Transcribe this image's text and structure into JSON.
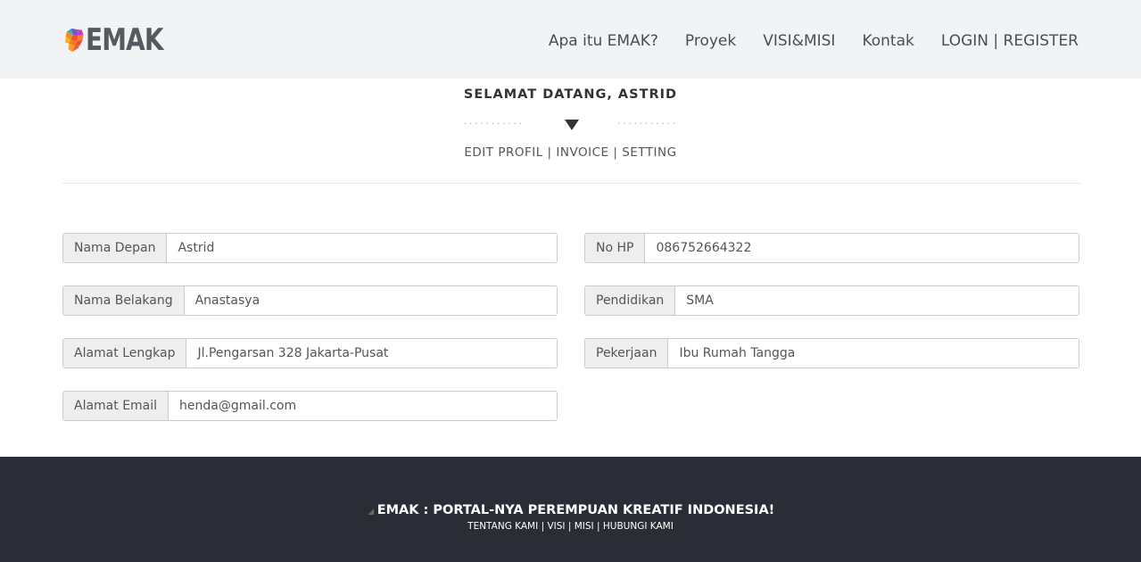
{
  "header": {
    "logo_text": "EMAK",
    "nav": [
      "Apa itu EMAK?",
      "Proyek",
      "VISI&MISI",
      "Kontak",
      "LOGIN | REGISTER"
    ]
  },
  "welcome": {
    "title": "SELAMAT DATANG, ASTRID",
    "dots": "...........",
    "menu": [
      "EDIT PROFIL",
      "INVOICE",
      "SETTING"
    ],
    "separator": "|"
  },
  "form": {
    "first_name": {
      "label": "Nama Depan",
      "value": "Astrid"
    },
    "last_name": {
      "label": "Nama Belakang",
      "value": "Anastasya"
    },
    "address": {
      "label": "Alamat Lengkap",
      "value": "Jl.Pengarsan 328 Jakarta-Pusat"
    },
    "email": {
      "label": "Alamat Email",
      "value": "henda@gmail.com"
    },
    "phone": {
      "label": "No HP",
      "value": "086752664322"
    },
    "education": {
      "label": "Pendidikan",
      "value": "SMA"
    },
    "job": {
      "label": "Pekerjaan",
      "value": "Ibu Rumah Tangga"
    }
  },
  "footer": {
    "title": "EMAK : PORTAL-NYA PEREMPUAN KREATIF INDONESIA!",
    "links": [
      "TENTANG KAMI",
      "VISI",
      "MISI",
      "HUBUNGI KAMI"
    ],
    "separator": "|"
  },
  "colors": {
    "header_bg": "#f2f3f5",
    "footer_bg": "#2a2d35",
    "label_bg": "#eeeeee"
  }
}
